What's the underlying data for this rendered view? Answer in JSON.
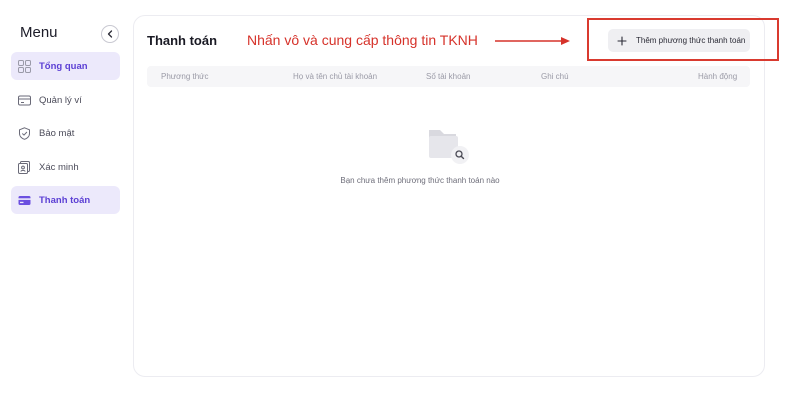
{
  "sidebar": {
    "title": "Menu",
    "items": [
      {
        "label": "Tổng quan",
        "icon": "grid-icon",
        "active": true
      },
      {
        "label": "Quản lý ví",
        "icon": "wallet-icon",
        "active": false
      },
      {
        "label": "Bảo mật",
        "icon": "shield-icon",
        "active": false
      },
      {
        "label": "Xác minh",
        "icon": "id-card-icon",
        "active": false
      },
      {
        "label": "Thanh toán",
        "icon": "credit-card-icon",
        "active": true
      }
    ]
  },
  "main": {
    "title": "Thanh toán",
    "add_button_label": "Thêm phương thức thanh toán",
    "table": {
      "columns": [
        "Phương thức",
        "Họ và tên chủ tài khoản",
        "Số tài khoản",
        "Ghi chú",
        "Hành động"
      ],
      "rows": []
    },
    "empty_message": "Bạn chưa thêm phương thức thanh toán nào"
  },
  "annotation": {
    "text": "Nhấn vô và cung cấp thông tin TKNH",
    "color": "#d6322a"
  },
  "colors": {
    "accent": "#5b3fd4",
    "accent_bg": "#ece9fb",
    "highlight": "#d93a2f"
  }
}
